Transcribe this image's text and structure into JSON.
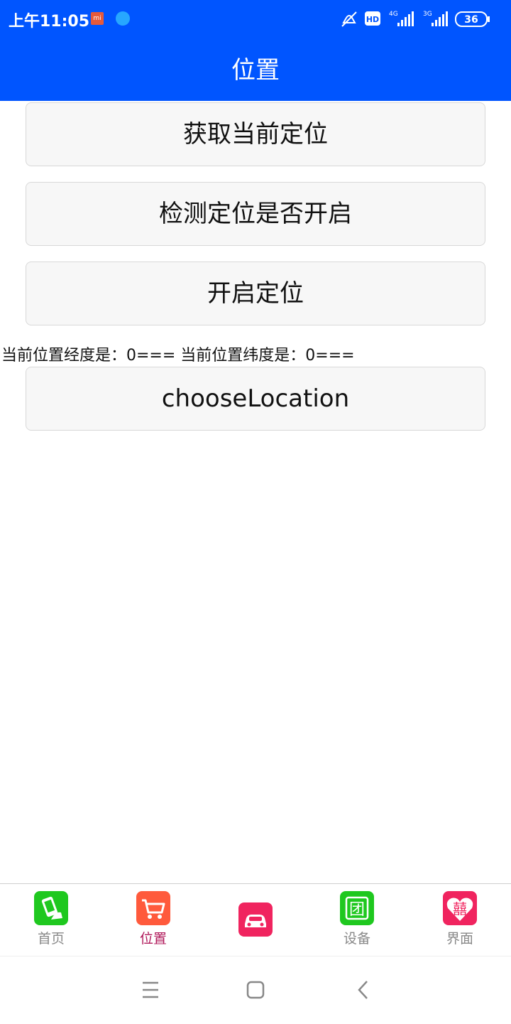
{
  "status_bar": {
    "time": "上午11:05",
    "mi_badge": "mi",
    "hd_badge": "HD",
    "net_1": "4G",
    "net_2": "3G",
    "battery": "36",
    "icons": [
      "mi-icon",
      "app-icon",
      "mute-icon",
      "hd-icon",
      "signal-4g-icon",
      "signal-3g-icon",
      "battery-icon"
    ],
    "bg_color": "#0055ff"
  },
  "header": {
    "title": "位置"
  },
  "main": {
    "buttons": [
      {
        "label": "获取当前定位"
      },
      {
        "label": "检测定位是否开启"
      },
      {
        "label": "开启定位"
      }
    ],
    "coords_text": "当前位置经度是：0=== 当前位置纬度是：0===",
    "choose_location_label": "chooseLocation"
  },
  "tabbar": {
    "active_color": "#b0185a",
    "tabs": [
      {
        "label": "首页",
        "icon": "phone-hand-icon",
        "color": "#1fc81f"
      },
      {
        "label": "位置",
        "icon": "shopping-cart-icon",
        "color": "#ff5a3c",
        "active": true
      },
      {
        "label": "",
        "icon": "car-icon",
        "color": "#f0245f"
      },
      {
        "label": "设备",
        "icon": "group-tuan-icon",
        "color": "#1fc81f"
      },
      {
        "label": "界面",
        "icon": "double-happiness-icon",
        "color": "#f0245f"
      }
    ],
    "tuan_glyph": "团",
    "xi_glyph": "囍"
  },
  "system_nav": {
    "icons": [
      "menu-icon",
      "home-icon",
      "back-icon"
    ]
  }
}
